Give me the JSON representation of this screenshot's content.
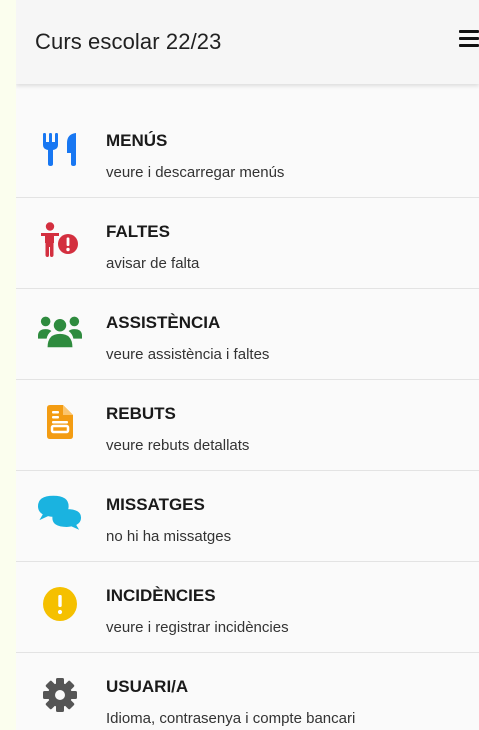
{
  "header": {
    "title": "Curs escolar 22/23"
  },
  "menu": [
    {
      "key": "menus",
      "title": "MENÚS",
      "subtitle": "veure i descarregar menús",
      "icon": "utensils-icon",
      "color": "#1877f2"
    },
    {
      "key": "faltes",
      "title": "FALTES",
      "subtitle": "avisar de falta",
      "icon": "child-alert-icon",
      "color": "#d32f3f"
    },
    {
      "key": "assistencia",
      "title": "ASSISTÈNCIA",
      "subtitle": "veure assistència i faltes",
      "icon": "users-icon",
      "color": "#2e8b3e"
    },
    {
      "key": "rebuts",
      "title": "REBUTS",
      "subtitle": "veure rebuts detallats",
      "icon": "receipt-icon",
      "color": "#f39c12"
    },
    {
      "key": "missatges",
      "title": "MISSATGES",
      "subtitle": "no hi ha missatges",
      "icon": "chat-bubbles-icon",
      "color": "#1ab3e0"
    },
    {
      "key": "incidencies",
      "title": "INCIDÈNCIES",
      "subtitle": "veure i registrar incidències",
      "icon": "exclamation-circle-icon",
      "color": "#f5c000"
    },
    {
      "key": "usuari",
      "title": "USUARI/A",
      "subtitle": "Idioma, contrasenya i compte bancari",
      "icon": "gear-icon",
      "color": "#555555"
    }
  ]
}
